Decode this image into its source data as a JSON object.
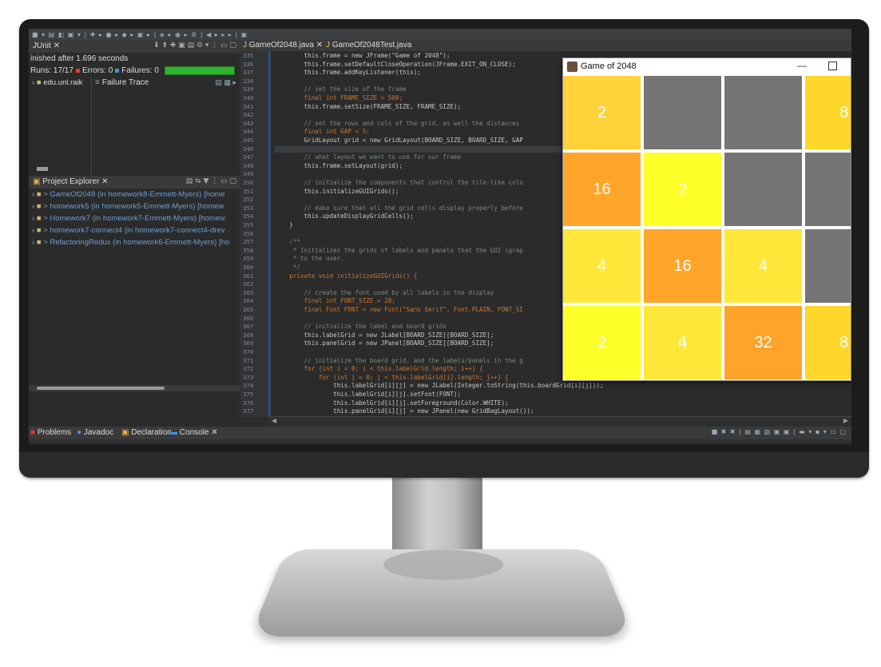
{
  "toolbar": {
    "icons_text": "■ ▾ ▤ ◧ ▣ ▾ | ✚ ▸ ● ▸ ◆ ▸ ▣ ▸ | ◈ ▸ ◉ ▸ ⚙ | ◀ ▸ ▸ ▸ | ▣"
  },
  "junit": {
    "tab_label": "JUnit",
    "status": "inished after 1.696 seconds",
    "runs": "Runs: 17/17",
    "errors": "Errors: 0",
    "failures": "Failures: 0",
    "tree_item": "edu.unl.raik",
    "failure_trace": "Failure Trace",
    "status_color": "#2fb22f"
  },
  "project_explorer": {
    "tab_label": "Project Explorer",
    "items": [
      "> GameOf2048 (in homework8-Emmett-Myers) [home",
      "> homework5 (in homework5-Emmett-Myers) [homew",
      "> Homework7 (in homework7-Emmett-Myers) [homew",
      "> homework7-connect4 (in homework7-connect4-drev",
      "> RefactoringRedux (in homework6-Emmett-Myers) [ho"
    ]
  },
  "editor": {
    "tabs": [
      "GameOf2048.java",
      "GameOf2048Test.java"
    ],
    "line_numbers": [
      "335",
      "336",
      "337",
      "338",
      "339",
      "340",
      "341",
      "342",
      "343",
      "344",
      "345",
      "346",
      "347",
      "348",
      "349",
      "350",
      "351",
      "352",
      "353",
      "354",
      "355",
      "356",
      "357",
      "358",
      "359",
      "360",
      "361",
      "362",
      "363",
      "364",
      "365",
      "366",
      "367",
      "368",
      "369",
      "370",
      "371",
      "372",
      "373",
      "374",
      "375",
      "376",
      "377"
    ],
    "lines": [
      {
        "t": "        this.frame = new JFrame(\"Game of 2048\");",
        "c": ""
      },
      {
        "t": "        this.frame.setDefaultCloseOperation(JFrame.EXIT_ON_CLOSE);",
        "c": ""
      },
      {
        "t": "        this.frame.addKeyListener(this);",
        "c": ""
      },
      {
        "t": "",
        "c": ""
      },
      {
        "t": "        // set the size of the frame",
        "c": "cm"
      },
      {
        "t": "        final int FRAME_SIZE = 500;",
        "c": "kw"
      },
      {
        "t": "        this.frame.setSize(FRAME_SIZE, FRAME_SIZE);",
        "c": ""
      },
      {
        "t": "",
        "c": ""
      },
      {
        "t": "        // set the rows and cols of the grid, as well the distances",
        "c": "cm"
      },
      {
        "t": "        final int GAP = 5;",
        "c": "kw"
      },
      {
        "t": "        GridLayout grid = new GridLayout(BOARD_SIZE, BOARD_SIZE, GAP",
        "c": ""
      },
      {
        "t": "",
        "c": "hl"
      },
      {
        "t": "        // what layout we want to use for our frame",
        "c": "cm"
      },
      {
        "t": "        this.frame.setLayout(grid);",
        "c": ""
      },
      {
        "t": "",
        "c": ""
      },
      {
        "t": "        // initialize the components that control the tile-like colo",
        "c": "cm"
      },
      {
        "t": "        this.initializeGUIGrids();",
        "c": ""
      },
      {
        "t": "",
        "c": ""
      },
      {
        "t": "        // make sure that all the grid cells display properly before",
        "c": "cm"
      },
      {
        "t": "        this.updateDisplayGridCells();",
        "c": ""
      },
      {
        "t": "    }",
        "c": ""
      },
      {
        "t": "",
        "c": ""
      },
      {
        "t": "    /**",
        "c": "cm"
      },
      {
        "t": "     * Initializes the grids of labels and panels that the GUI (grap",
        "c": "cm"
      },
      {
        "t": "     * to the user.",
        "c": "cm"
      },
      {
        "t": "     */",
        "c": "cm"
      },
      {
        "t": "    private void initializeGUIGrids() {",
        "c": "kw"
      },
      {
        "t": "",
        "c": ""
      },
      {
        "t": "        // create the font used by all labels in the display",
        "c": "cm"
      },
      {
        "t": "        final int FONT_SIZE = 28;",
        "c": "kw"
      },
      {
        "t": "        final Font FONT = new Font(\"Sans Serif\", Font.PLAIN, FONT_SI",
        "c": "kw"
      },
      {
        "t": "",
        "c": ""
      },
      {
        "t": "        // initialize the label and board grids",
        "c": "cm"
      },
      {
        "t": "        this.labelGrid = new JLabel[BOARD_SIZE][BOARD_SIZE];",
        "c": ""
      },
      {
        "t": "        this.panelGrid = new JPanel[BOARD_SIZE][BOARD_SIZE];",
        "c": ""
      },
      {
        "t": "",
        "c": ""
      },
      {
        "t": "        // initialize the board grid, and the labels/panels in the g",
        "c": "cm"
      },
      {
        "t": "        for (int i = 0; i < this.labelGrid.length; i++) {",
        "c": "kw"
      },
      {
        "t": "            for (int j = 0; j < this.labelGrid[i].length; j++) {",
        "c": "kw"
      },
      {
        "t": "                this.labelGrid[i][j] = new JLabel(Integer.toString(this.boardGrid[i][j]));",
        "c": ""
      },
      {
        "t": "                this.labelGrid[i][j].setFont(FONT);",
        "c": ""
      },
      {
        "t": "                this.labelGrid[i][j].setForeground(Color.WHITE);",
        "c": ""
      },
      {
        "t": "                this.panelGrid[i][j] = new JPanel(new GridBagLayout());",
        "c": ""
      }
    ]
  },
  "bottom_tabs": {
    "problems": "Problems",
    "javadoc": "Javadoc",
    "declaration": "Declaration",
    "console": "Console"
  },
  "game": {
    "title": "Game of 2048",
    "colors": {
      "empty": "#757575",
      "c2": "#ffd23a",
      "c4": "#ffe83a",
      "c8": "#ffd72a",
      "c16": "#ffa62a",
      "c32": "#ffa32a",
      "c2b": "#ffff2a"
    },
    "tiles": [
      {
        "label": "2",
        "color": "#ffd23a"
      },
      {
        "label": "",
        "color": "#757575"
      },
      {
        "label": "",
        "color": "#757575"
      },
      {
        "label": "8",
        "color": "#ffd72a"
      },
      {
        "label": "16",
        "color": "#ffa62a"
      },
      {
        "label": "2",
        "color": "#ffff2a"
      },
      {
        "label": "",
        "color": "#757575"
      },
      {
        "label": "",
        "color": "#757575"
      },
      {
        "label": "4",
        "color": "#ffe83a"
      },
      {
        "label": "16",
        "color": "#ffa62a"
      },
      {
        "label": "4",
        "color": "#ffe83a"
      },
      {
        "label": "",
        "color": "#757575"
      },
      {
        "label": "2",
        "color": "#ffff2a"
      },
      {
        "label": "4",
        "color": "#ffe83a"
      },
      {
        "label": "32",
        "color": "#ffa32a"
      },
      {
        "label": "8",
        "color": "#ffd72a"
      }
    ]
  }
}
